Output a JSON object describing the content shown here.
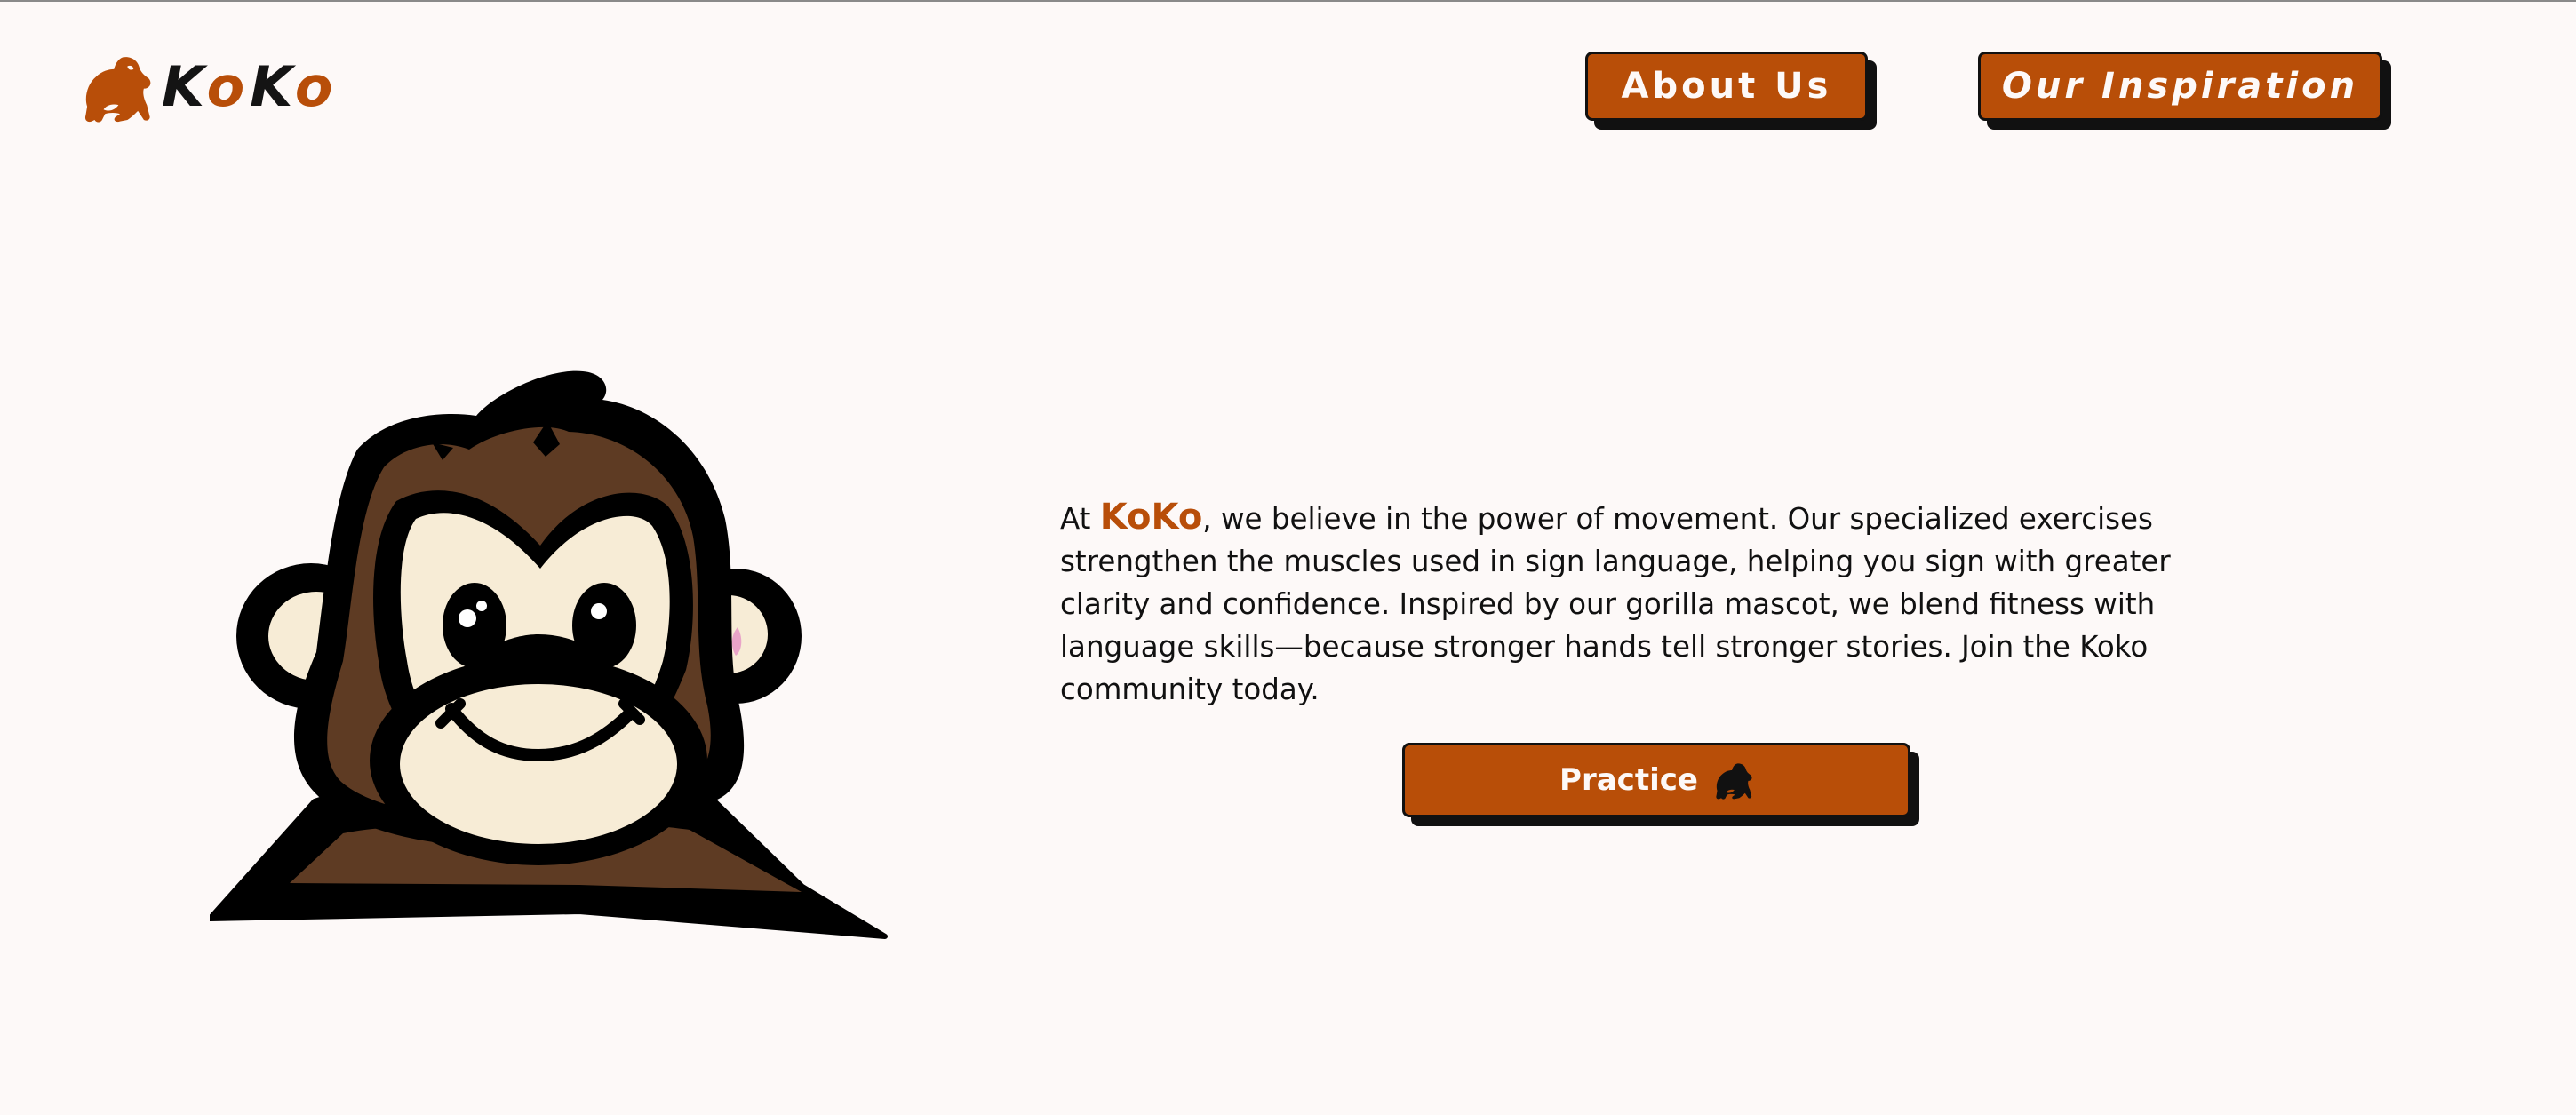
{
  "header": {
    "logo_icon": "gorilla-icon",
    "logo_letters": [
      "K",
      "o",
      "K",
      "o"
    ],
    "nav": {
      "about_label": "About Us",
      "inspiration_label": "Our Inspiration"
    }
  },
  "hero": {
    "mascot": "gorilla-mascot-illustration",
    "intro": {
      "prefix": "At ",
      "brand": "KoKo",
      "body": ", we believe in the power of movement. Our specialized exercises strengthen the muscles used in sign language, helping you sign with greater clarity and confidence. Inspired by our gorilla mascot, we blend fitness with language skills—because stronger hands tell stronger stories. Join the Koko community today."
    },
    "cta": {
      "label": "Practice",
      "icon": "gorilla-icon"
    }
  },
  "colors": {
    "background": "#fdf9f8",
    "accent": "#b84e08",
    "text": "#111111",
    "mascot_fur": "#5e3b23",
    "mascot_face": "#f7ecd6",
    "mascot_ear_inner": "#e9a4c8"
  }
}
